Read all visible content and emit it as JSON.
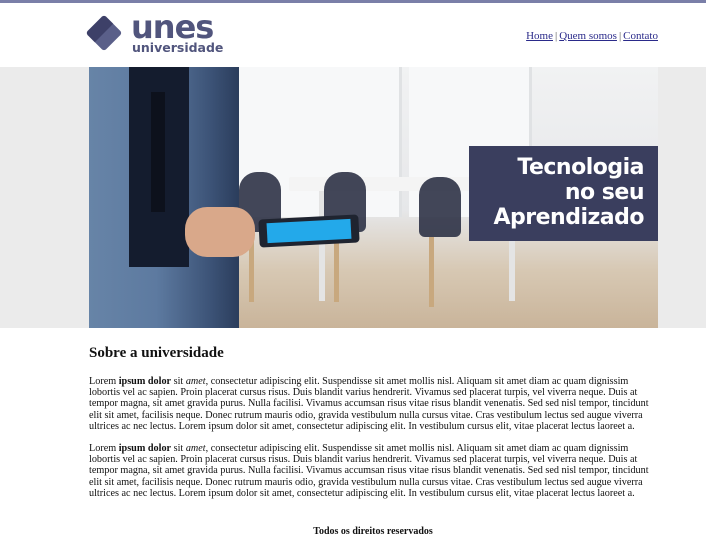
{
  "header": {
    "logo": {
      "name": "unes",
      "subtitle": "universidade"
    },
    "nav": [
      {
        "label": "Home"
      },
      {
        "label": "Quem somos"
      },
      {
        "label": "Contato"
      }
    ],
    "nav_separator": "|"
  },
  "banner": {
    "tagline": [
      "Tecnologia",
      "no seu",
      "Aprendizado"
    ]
  },
  "content": {
    "title": "Sobre a universidade",
    "paragraphs": [
      {
        "lead": "Lorem ",
        "bold": "ipsum dolor",
        "mid": " sit ",
        "italic": "amet",
        "rest": ", consectetur adipiscing elit. Suspendisse sit amet mollis nisl. Aliquam sit amet diam ac quam dignissim lobortis vel ac sapien. Proin placerat cursus risus. Duis blandit varius hendrerit. Vivamus sed placerat turpis, vel viverra neque. Duis at tempor magna, sit amet gravida purus. Nulla facilisi. Vivamus accumsan risus vitae risus blandit venenatis. Sed sed nisl tempor, tincidunt elit sit amet, facilisis neque. Donec rutrum mauris odio, gravida vestibulum nulla cursus vitae. Cras vestibulum lectus sed augue viverra ultrices ac nec lectus. Lorem ipsum dolor sit amet, consectetur adipiscing elit. In vestibulum cursus elit, vitae placerat lectus laoreet a."
      },
      {
        "lead": "Lorem ",
        "bold": "ipsum dolor",
        "mid": " sit ",
        "italic": "amet",
        "rest": ", consectetur adipiscing elit. Suspendisse sit amet mollis nisl. Aliquam sit amet diam ac quam dignissim lobortis vel ac sapien. Proin placerat cursus risus. Duis blandit varius hendrerit. Vivamus sed placerat turpis, vel viverra neque. Duis at tempor magna, sit amet gravida purus. Nulla facilisi. Vivamus accumsan risus vitae risus blandit venenatis. Sed sed nisl tempor, tincidunt elit sit amet, facilisis neque. Donec rutrum mauris odio, gravida vestibulum nulla cursus vitae. Cras vestibulum lectus sed augue viverra ultrices ac nec lectus. Lorem ipsum dolor sit amet, consectetur adipiscing elit. In vestibulum cursus elit, vitae placerat lectus laoreet a."
      }
    ]
  },
  "footer": {
    "text": "Todos os direitos reservados"
  },
  "colors": {
    "brand": "#51557d",
    "tagline_bg": "#3a3e5e",
    "top_rule": "#7a7fa8"
  }
}
